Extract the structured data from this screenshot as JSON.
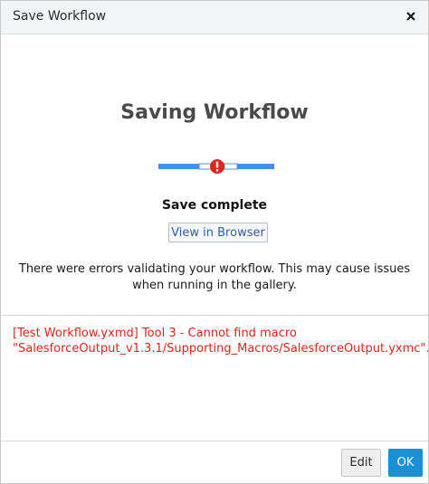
{
  "dialog": {
    "title": "Save Workflow",
    "close_icon": "close-icon"
  },
  "main": {
    "heading": "Saving Workflow",
    "progress_icon": "error-exclamation-icon",
    "status": "Save complete",
    "view_button": "View in Browser",
    "message": "There were errors validating your workflow. This may cause issues when running in the gallery.",
    "error": "[Test Workflow.yxmd] Tool 3 - Cannot find macro \"SalesforceOutput_v1.3.1/Supporting_Macros/SalesforceOutput.yxmc\"."
  },
  "footer": {
    "edit_button": "Edit",
    "ok_button": "OK"
  },
  "colors": {
    "accent_blue": "#4a90e2",
    "error_red": "#e2231a",
    "ok_button": "#1b8fd6"
  }
}
